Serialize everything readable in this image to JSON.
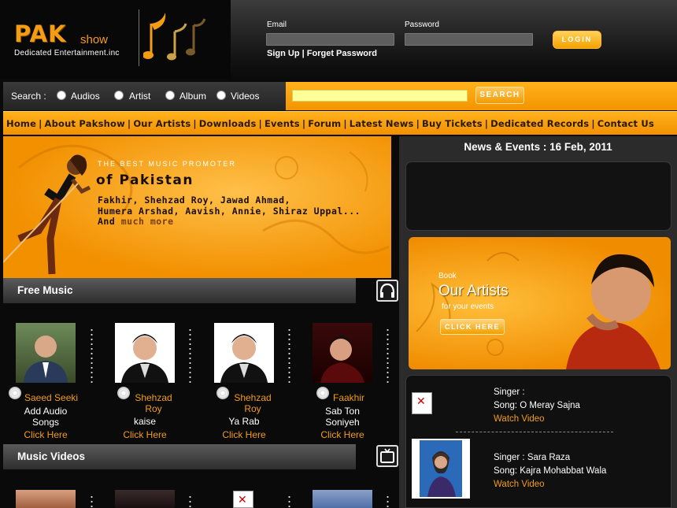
{
  "header": {
    "logo_main": "PAK",
    "logo_sub": "show",
    "tagline": "Dedicated Entertainment.inc",
    "email_label": "Email",
    "password_label": "Password",
    "login_label": "LOGIN",
    "signup_label": "Sign Up",
    "signup_sep": "|",
    "forgot_label": "Forget Password"
  },
  "search": {
    "label": "Search :",
    "options": [
      "Audios",
      "Artist",
      "Album",
      "Videos"
    ],
    "button_label": "SEARCH"
  },
  "nav": {
    "items": [
      "Home",
      "About Pakshow",
      "Our Artists",
      "Downloads",
      "Events",
      "Forum",
      "Latest News",
      "Buy Tickets",
      "Dedicated Records",
      "Contact Us"
    ]
  },
  "hero": {
    "small_caption": "THE BEST MUSIC PROMOTER",
    "title": "of Pakistan",
    "names_line1": "Fakhir, Shehzad Roy, Jawad Ahmad,",
    "names_line2": "Humera Arshad, Aavish, Annie, Shiraz Uppal...",
    "names_line3": "And",
    "names_more": "much more"
  },
  "free_music": {
    "title": "Free Music",
    "tiles": [
      {
        "artist": "Saeed Seeki",
        "song": "Add Audio Songs",
        "click": "Click Here"
      },
      {
        "artist": "Shehzad Roy",
        "song": "kaise",
        "click": "Click Here"
      },
      {
        "artist": "Shehzad Roy",
        "song": "Ya Rab",
        "click": "Click Here"
      },
      {
        "artist": "Faakhir",
        "song": "Sab Ton Soniyeh",
        "click": "Click Here"
      }
    ]
  },
  "music_videos": {
    "title": "Music Videos"
  },
  "news": {
    "title": "News & Events : 16 Feb, 2011"
  },
  "book": {
    "small": "Book",
    "big": "Our Artists",
    "sub": "for your events",
    "button": "CLICK HERE"
  },
  "videos": [
    {
      "singer": "Singer :",
      "song": "Song: O Meray Sajna",
      "watch": "Watch Video"
    },
    {
      "singer": "Singer : Sara Raza",
      "song": "Song: Kajra Mohabbat Wala",
      "watch": "Watch Video"
    }
  ],
  "colors": {
    "accent": "#f39c14",
    "nav_text": "#2a1800"
  }
}
